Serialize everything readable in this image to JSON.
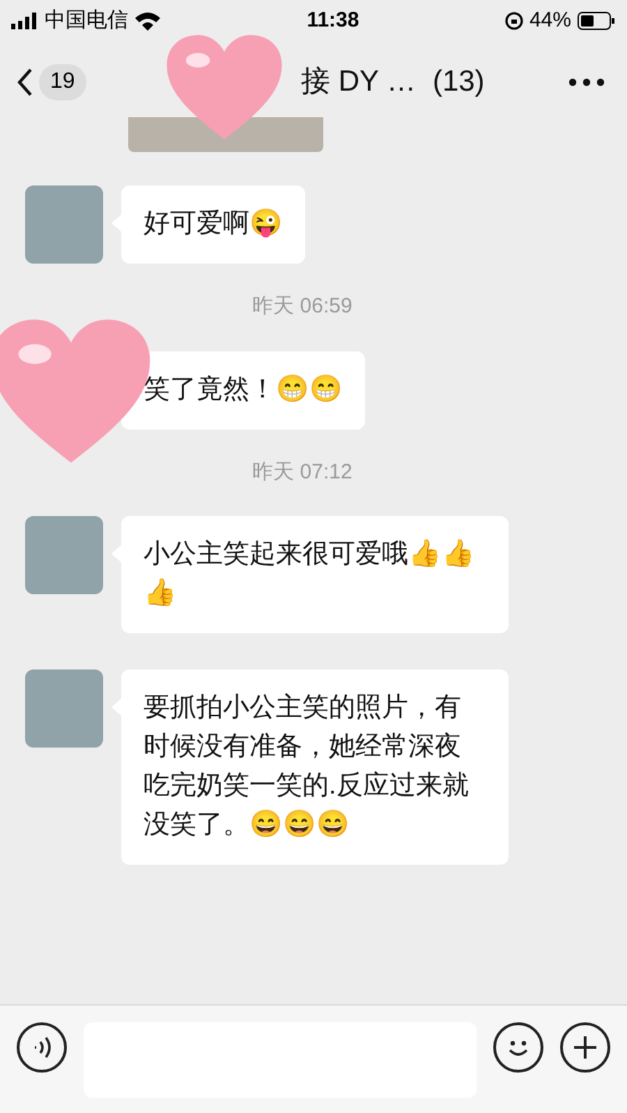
{
  "status_bar": {
    "carrier": "中国电信",
    "time": "11:38",
    "battery": "44%"
  },
  "nav": {
    "unread": "19",
    "title": "接 DY …",
    "count": "(13)"
  },
  "messages": [
    {
      "kind": "image"
    },
    {
      "kind": "text",
      "avatar_covered": false,
      "text": "好可爱啊😜"
    },
    {
      "kind": "time",
      "text": "昨天 06:59"
    },
    {
      "kind": "text",
      "avatar_covered": true,
      "text": "笑了竟然！😁😁"
    },
    {
      "kind": "time",
      "text": "昨天 07:12"
    },
    {
      "kind": "text",
      "avatar_covered": false,
      "text": "小公主笑起来很可爱哦👍👍👍"
    },
    {
      "kind": "text",
      "avatar_covered": false,
      "text": "要抓拍小公主笑的照片，有时候没有准备，她经常深夜吃完奶笑一笑的.反应过来就没笑了。😄😄😄"
    }
  ]
}
